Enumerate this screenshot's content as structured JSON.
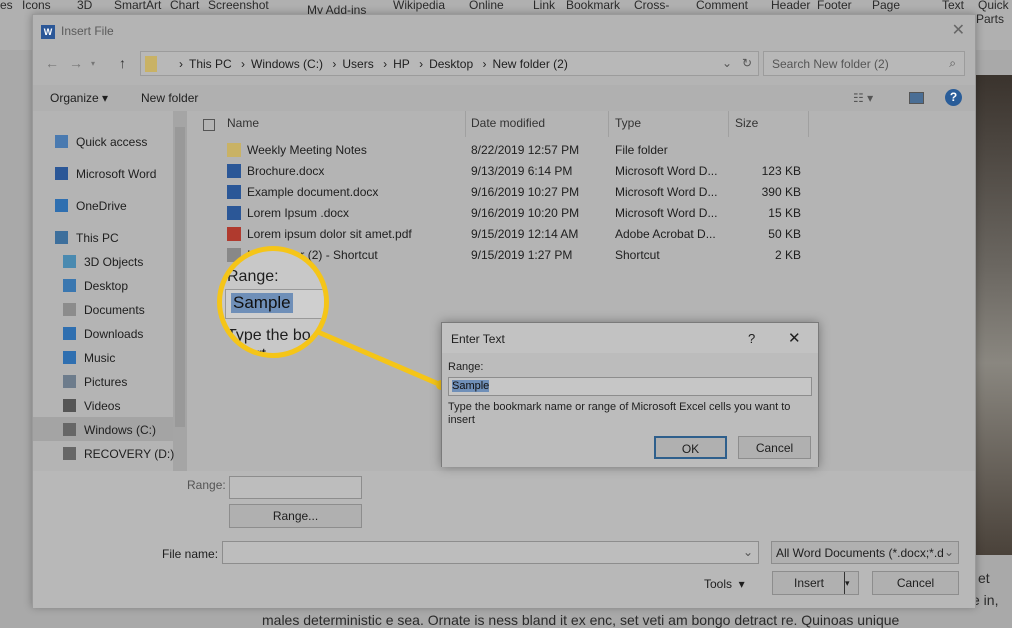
{
  "ribbon": {
    "items": [
      "es",
      "Icons",
      "3D",
      "SmartArt",
      "Chart",
      "Screenshot",
      "My Add-ins",
      "Wikipedia",
      "Online",
      "Link",
      "Bookmark",
      "Cross-",
      "Comment",
      "Header",
      "Footer",
      "Page",
      "Text",
      "Quick",
      "Parts"
    ]
  },
  "document": {
    "line1": "males deterministic e sea. Ornate is ness bland it ex enc, set veti am bongo detract re. Quinoas unique",
    "frag_right1": "et",
    "frag_right2": "e in,"
  },
  "dialog": {
    "title": "Insert File",
    "breadcrumb": [
      "This PC",
      "Windows (C:)",
      "Users",
      "HP",
      "Desktop",
      "New folder (2)"
    ],
    "search_placeholder": "Search New folder (2)",
    "toolbar": {
      "organize": "Organize",
      "new_folder": "New folder"
    },
    "sidebar": [
      {
        "label": "Quick access",
        "icon": "star-icon"
      },
      {
        "label": "Microsoft Word",
        "icon": "word-icon"
      },
      {
        "label": "OneDrive",
        "icon": "cloud-icon"
      },
      {
        "label": "This PC",
        "icon": "computer-icon"
      },
      {
        "label": "3D Objects",
        "icon": "cube-icon"
      },
      {
        "label": "Desktop",
        "icon": "desktop-icon"
      },
      {
        "label": "Documents",
        "icon": "documents-icon"
      },
      {
        "label": "Downloads",
        "icon": "download-icon"
      },
      {
        "label": "Music",
        "icon": "music-icon"
      },
      {
        "label": "Pictures",
        "icon": "pictures-icon"
      },
      {
        "label": "Videos",
        "icon": "videos-icon"
      },
      {
        "label": "Windows (C:)",
        "icon": "drive-icon"
      },
      {
        "label": "RECOVERY (D:)",
        "icon": "drive-icon"
      }
    ],
    "columns": [
      "Name",
      "Date modified",
      "Type",
      "Size"
    ],
    "files": [
      {
        "name": "Weekly Meeting Notes",
        "date": "8/22/2019 12:57 PM",
        "type": "File folder",
        "size": "",
        "icon": "folder-icon"
      },
      {
        "name": "Brochure.docx",
        "date": "9/13/2019 6:14 PM",
        "type": "Microsoft Word D...",
        "size": "123 KB",
        "icon": "word-doc-icon"
      },
      {
        "name": "Example document.docx",
        "date": "9/16/2019 10:27 PM",
        "type": "Microsoft Word D...",
        "size": "390 KB",
        "icon": "word-doc-icon"
      },
      {
        "name": "Lorem Ipsum .docx",
        "date": "9/16/2019 10:20 PM",
        "type": "Microsoft Word D...",
        "size": "15 KB",
        "icon": "word-doc-icon"
      },
      {
        "name": "Lorem ipsum dolor sit amet.pdf",
        "date": "9/15/2019 12:14 AM",
        "type": "Adobe Acrobat D...",
        "size": "50 KB",
        "icon": "pdf-icon"
      },
      {
        "name": "New folder (2) - Shortcut",
        "date": "9/15/2019 1:27 PM",
        "type": "Shortcut",
        "size": "2 KB",
        "icon": "shortcut-icon"
      }
    ],
    "range_label": "Range:",
    "range_value": "",
    "range_button": "Range...",
    "filename_label": "File name:",
    "filename_value": "",
    "filetype": "All Word Documents (*.docx;*.d",
    "tools": "Tools",
    "insert": "Insert",
    "cancel": "Cancel"
  },
  "enter_text": {
    "title": "Enter Text",
    "help": "?",
    "range_label": "Range:",
    "range_value": "Sample",
    "description": "Type the bookmark name or range of Microsoft Excel cells you want to insert",
    "ok": "OK",
    "cancel": "Cancel"
  },
  "magnifier": {
    "label": "Range:",
    "value": "Sample",
    "text1": "Type the bo",
    "text2": "insert",
    "accent": "#f5c518"
  }
}
